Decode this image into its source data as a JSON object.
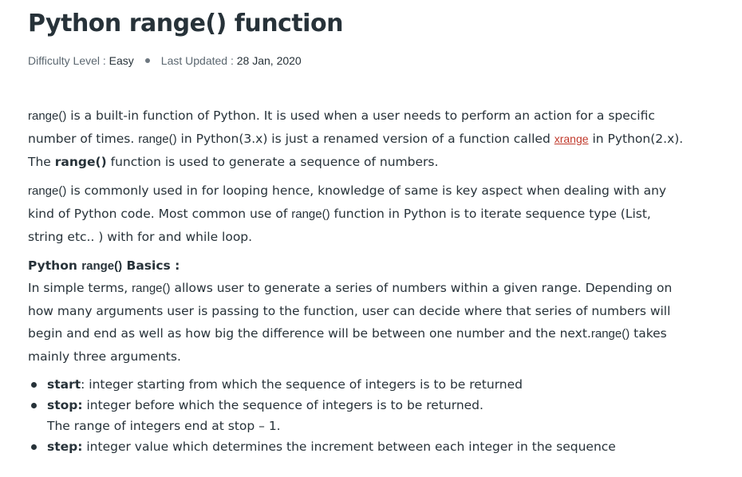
{
  "article": {
    "title": "Python range() function",
    "meta": {
      "difficulty_label": "Difficulty Level : ",
      "difficulty_value": "Easy",
      "updated_label": "Last Updated : ",
      "updated_value": "28 Jan, 2020"
    },
    "p1": {
      "code1": "range()",
      "t1": " is a built-in function of Python. It is used when a user needs to perform an action for a specific number of times. ",
      "code2": "range()",
      "t2": " in Python(3.x) is just a renamed version of a function called ",
      "link": "xrange",
      "t3": " in Python(2.x). The ",
      "bold": "range()",
      "t4": " function is used to generate a sequence of numbers."
    },
    "p2": {
      "code1": "range()",
      "t1": " is commonly used in for looping hence, knowledge of same is key aspect when dealing with any kind of Python code. Most common use of ",
      "code2": "range()",
      "t2": " function in Python is to iterate sequence type (List, string etc.. ) with for and while loop."
    },
    "basics_heading": {
      "t1": "Python ",
      "code": "range()",
      "t2": " Basics :"
    },
    "p3": {
      "t1": "In simple terms, ",
      "code1": "range()",
      "t2": " allows user to generate a series of numbers within a given range. Depending on how many arguments user is passing to the function, user can decide where that series of numbers will begin and end as well as how big the difference will be between one number and the next.",
      "code2": "range()",
      "t3": " takes mainly three arguments."
    },
    "args": [
      {
        "name": "start",
        "desc": ": integer starting from which the sequence of integers is to be returned",
        "sub": ""
      },
      {
        "name": "stop:",
        "desc": " integer before which the sequence of integers is to be returned.",
        "sub": "The range of integers end at stop – 1."
      },
      {
        "name": "step:",
        "desc": " integer value which determines the increment between each integer in the sequence",
        "sub": ""
      }
    ]
  }
}
